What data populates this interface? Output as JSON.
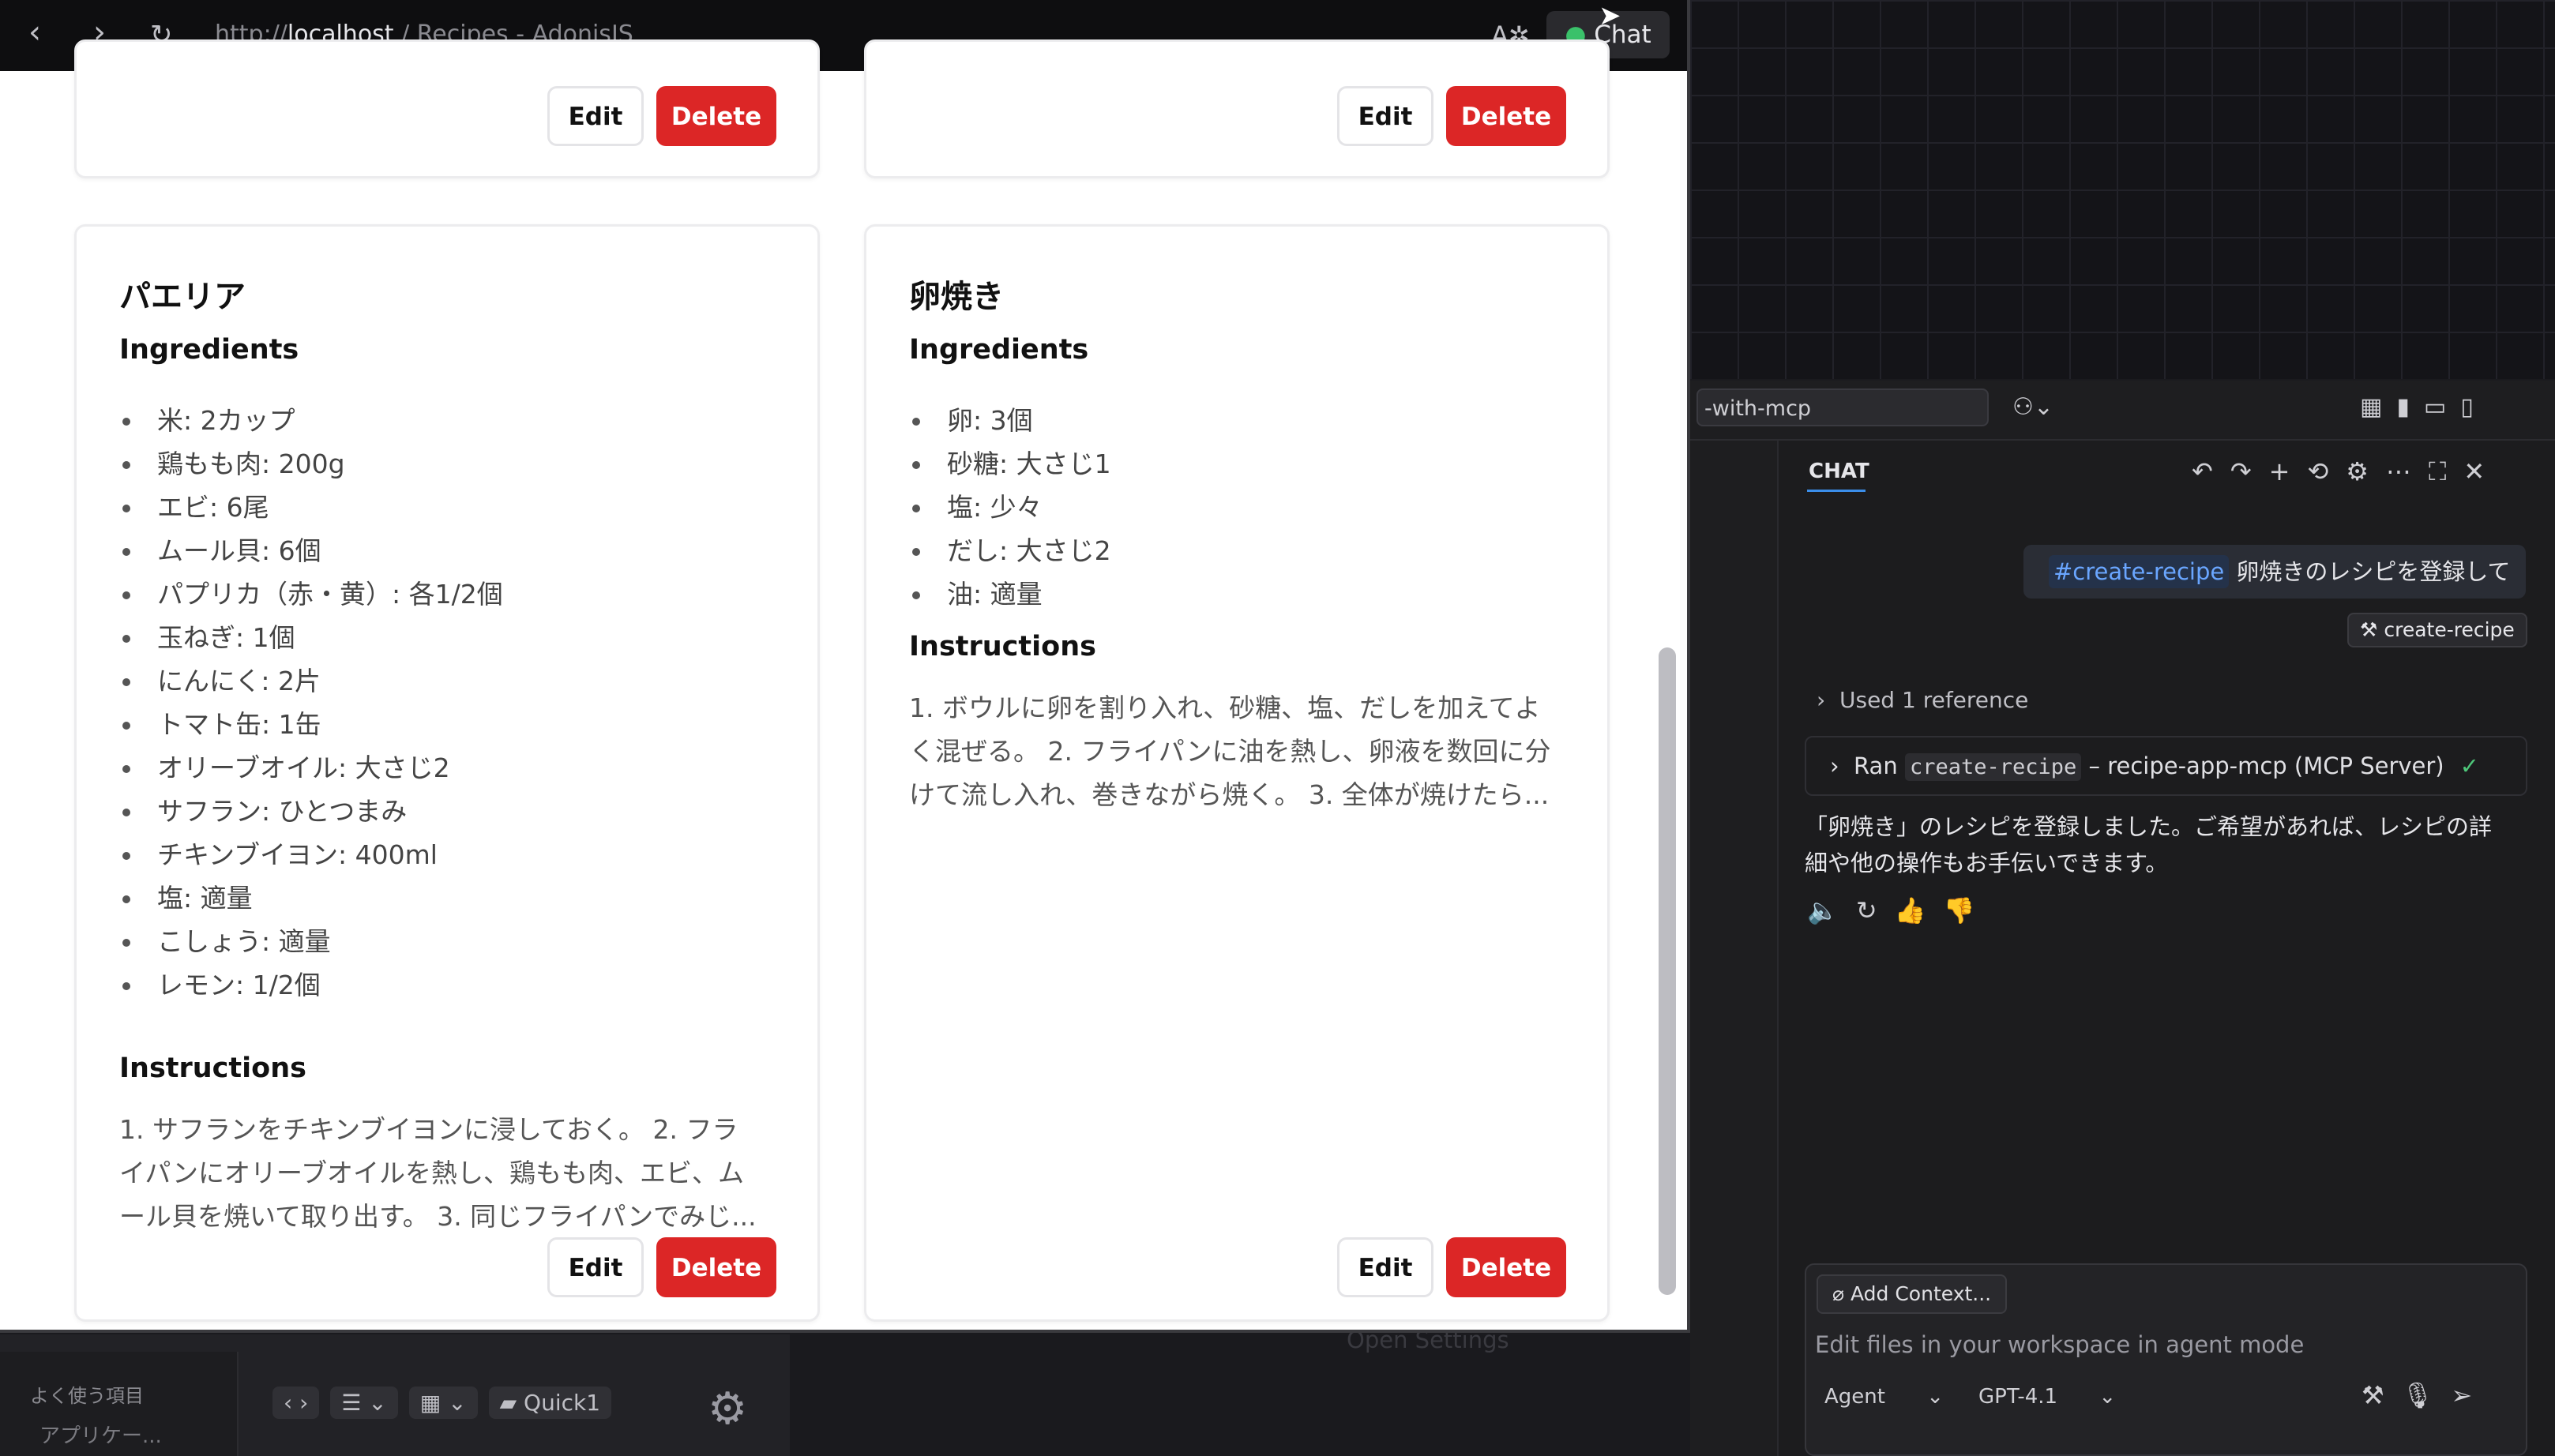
{
  "browser": {
    "url_prefix": "http://",
    "url_host": "localhost",
    "url_rest": " / Recipes - AdonisJS",
    "chat_button": "Chat"
  },
  "cards_top": [
    {
      "edit": "Edit",
      "delete": "Delete"
    },
    {
      "edit": "Edit",
      "delete": "Delete"
    }
  ],
  "recipes": [
    {
      "title": "パエリア",
      "ingredients_heading": "Ingredients",
      "ingredients": [
        "米: 2カップ",
        "鶏もも肉: 200g",
        "エビ: 6尾",
        "ムール貝: 6個",
        "パプリカ（赤・黄）: 各1/2個",
        "玉ねぎ: 1個",
        "にんにく: 2片",
        "トマト缶: 1缶",
        "オリーブオイル: 大さじ2",
        "サフラン: ひとつまみ",
        "チキンブイヨン: 400ml",
        "塩: 適量",
        "こしょう: 適量",
        "レモン: 1/2個"
      ],
      "instructions_heading": "Instructions",
      "instructions_lines": [
        "1. サフランをチキンブイヨンに浸しておく。 2. フラ",
        "イパンにオリーブオイルを熱し、鶏もも肉、エビ、ム",
        "ール貝を焼いて取り出す。 3. 同じフライパンでみじ..."
      ],
      "edit": "Edit",
      "delete": "Delete"
    },
    {
      "title": "卵焼き",
      "ingredients_heading": "Ingredients",
      "ingredients": [
        "卵: 3個",
        "砂糖: 大さじ1",
        "塩: 少々",
        "だし: 大さじ2",
        "油: 適量"
      ],
      "instructions_heading": "Instructions",
      "instructions_lines": [
        "1. ボウルに卵を割り入れ、砂糖、塩、だしを加えてよ",
        "く混ぜる。 2. フライパンに油を熱し、卵液を数回に分",
        "けて流し入れ、巻きながら焼く。 3. 全体が焼けたら..."
      ],
      "edit": "Edit",
      "delete": "Delete"
    }
  ],
  "vscode": {
    "search_text": "-with-mcp",
    "chat_tab": "CHAT",
    "user_ref": "#create-recipe",
    "user_text": " 卵焼きのレシピを登録して",
    "tool_chip": "create-recipe",
    "used_reference": "Used 1 reference",
    "ran_prefix": "Ran ",
    "ran_tool": "create-recipe",
    "ran_suffix": " – recipe-app-mcp (MCP Server)",
    "reply_lines": [
      "「卵焼き」のレシピを登録しました。ご希望があれば、レシピの詳",
      "細や他の操作もお手伝いできます。"
    ],
    "add_context": "Add Context...",
    "input_placeholder": "Edit files in your workspace in agent mode",
    "mode": "Agent",
    "model": "GPT-4.1",
    "open_settings": "Open Settings"
  },
  "finder": {
    "favorites": "よく使う項目",
    "app": "アプリケー...",
    "folder": "Quick1"
  }
}
